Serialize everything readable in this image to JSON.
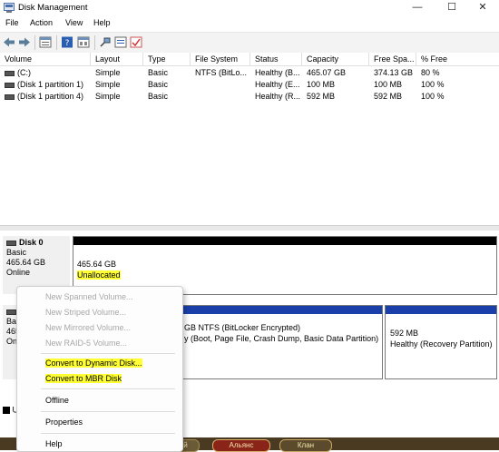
{
  "window": {
    "title": "Disk Management",
    "controls": {
      "minimize": "—",
      "maximize": "☐",
      "close": "✕"
    }
  },
  "menu": [
    "File",
    "Action",
    "View",
    "Help"
  ],
  "table": {
    "headers": [
      "Volume",
      "Layout",
      "Type",
      "File System",
      "Status",
      "Capacity",
      "Free Spa...",
      "% Free"
    ],
    "rows": [
      [
        "(C:)",
        "Simple",
        "Basic",
        "NTFS (BitLo...",
        "Healthy (B...",
        "465.07 GB",
        "374.13 GB",
        "80 %"
      ],
      [
        "(Disk 1 partition 1)",
        "Simple",
        "Basic",
        "",
        "Healthy (E...",
        "100 MB",
        "100 MB",
        "100 %"
      ],
      [
        "(Disk 1 partition 4)",
        "Simple",
        "Basic",
        "",
        "Healthy (R...",
        "592 MB",
        "592 MB",
        "100 %"
      ]
    ]
  },
  "disks": {
    "disk0": {
      "name": "Disk 0",
      "type": "Basic",
      "size": "465.64 GB",
      "status": "Online",
      "partition": {
        "size": "465.64 GB",
        "label": "Unallocated"
      }
    },
    "disk1": {
      "name_partial": "Bas",
      "size_partial": "465",
      "status_partial": "On",
      "partition_c": {
        "line1": "GB NTFS (BitLocker Encrypted)",
        "line2": "y (Boot, Page File, Crash Dump, Basic Data Partition)"
      },
      "partition_rec": {
        "line1": "592 MB",
        "line2": "Healthy (Recovery Partition)"
      }
    },
    "legend_partial": "U"
  },
  "context_menu": {
    "new_spanned": "New Spanned Volume...",
    "new_striped": "New Striped Volume...",
    "new_mirrored": "New Mirrored Volume...",
    "new_raid5": "New RAID-5 Volume...",
    "convert_dynamic": "Convert to Dynamic Disk...",
    "convert_mbr": "Convert to MBR Disk",
    "offline": "Offline",
    "properties": "Properties",
    "help": "Help"
  },
  "taskbar": {
    "item1": "Альянс",
    "item2": "Клан",
    "item0_partial": "рой"
  },
  "colors": {
    "highlight": "#ffff33",
    "primary_bar": "#1a3fa8",
    "unallocated_bar": "#000000"
  }
}
